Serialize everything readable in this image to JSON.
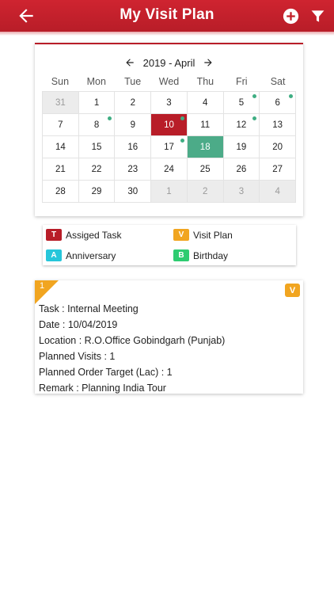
{
  "header": {
    "title": "My Visit Plan"
  },
  "calendar": {
    "month_label": "2019 - April",
    "weekdays": [
      "Sun",
      "Mon",
      "Tue",
      "Wed",
      "Thu",
      "Fri",
      "Sat"
    ],
    "days": [
      {
        "day": "31",
        "state": "other",
        "dot": false
      },
      {
        "day": "1",
        "state": "normal",
        "dot": false
      },
      {
        "day": "2",
        "state": "normal",
        "dot": false
      },
      {
        "day": "3",
        "state": "normal",
        "dot": false
      },
      {
        "day": "4",
        "state": "normal",
        "dot": false
      },
      {
        "day": "5",
        "state": "normal",
        "dot": true
      },
      {
        "day": "6",
        "state": "normal",
        "dot": true
      },
      {
        "day": "7",
        "state": "normal",
        "dot": false
      },
      {
        "day": "8",
        "state": "normal",
        "dot": true
      },
      {
        "day": "9",
        "state": "normal",
        "dot": false
      },
      {
        "day": "10",
        "state": "selected",
        "dot": true
      },
      {
        "day": "11",
        "state": "normal",
        "dot": false
      },
      {
        "day": "12",
        "state": "normal",
        "dot": true
      },
      {
        "day": "13",
        "state": "normal",
        "dot": false
      },
      {
        "day": "14",
        "state": "normal",
        "dot": false
      },
      {
        "day": "15",
        "state": "normal",
        "dot": false
      },
      {
        "day": "16",
        "state": "normal",
        "dot": false
      },
      {
        "day": "17",
        "state": "normal",
        "dot": true
      },
      {
        "day": "18",
        "state": "today",
        "dot": false
      },
      {
        "day": "19",
        "state": "normal",
        "dot": false
      },
      {
        "day": "20",
        "state": "normal",
        "dot": false
      },
      {
        "day": "21",
        "state": "normal",
        "dot": false
      },
      {
        "day": "22",
        "state": "normal",
        "dot": false
      },
      {
        "day": "23",
        "state": "normal",
        "dot": false
      },
      {
        "day": "24",
        "state": "normal",
        "dot": false
      },
      {
        "day": "25",
        "state": "normal",
        "dot": false
      },
      {
        "day": "26",
        "state": "normal",
        "dot": false
      },
      {
        "day": "27",
        "state": "normal",
        "dot": false
      },
      {
        "day": "28",
        "state": "normal",
        "dot": false
      },
      {
        "day": "29",
        "state": "normal",
        "dot": false
      },
      {
        "day": "30",
        "state": "normal",
        "dot": false
      },
      {
        "day": "1",
        "state": "other",
        "dot": false
      },
      {
        "day": "2",
        "state": "other",
        "dot": false
      },
      {
        "day": "3",
        "state": "other",
        "dot": false
      },
      {
        "day": "4",
        "state": "other",
        "dot": false
      }
    ]
  },
  "legend": [
    {
      "badge": "T",
      "label": "Assiged Task",
      "color": "#b81d28"
    },
    {
      "badge": "V",
      "label": "Visit Plan",
      "color": "#f1a520"
    },
    {
      "badge": "A",
      "label": "Anniversary",
      "color": "#26c6da"
    },
    {
      "badge": "B",
      "label": "Birthday",
      "color": "#2ecc71"
    }
  ],
  "visit_card": {
    "number": "1",
    "type_badge": "V",
    "lines": [
      "Task : Internal Meeting",
      "Date : 10/04/2019",
      "Location : R.O.Office Gobindgarh (Punjab)",
      "Planned Visits : 1",
      "Planned Order Target (Lac) : 1",
      "Remark : Planning India Tour"
    ]
  },
  "colors": {
    "primary": "#b81d28",
    "today": "#4cab88",
    "event_dot": "#3fae83",
    "visit_plan": "#f1a520"
  },
  "icons": [
    "back-arrow-icon",
    "add-circle-icon",
    "filter-icon",
    "chevron-left-icon",
    "chevron-right-icon"
  ]
}
